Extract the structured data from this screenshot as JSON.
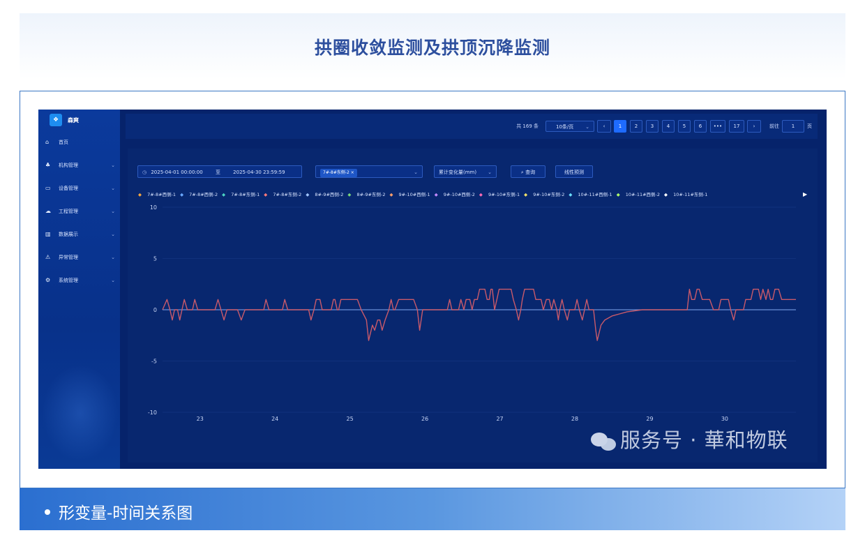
{
  "header": {
    "title": "拱圈收敛监测及拱顶沉降监测"
  },
  "app": {
    "logo_text": "森爽",
    "menu": [
      {
        "label": "首页",
        "icon": "home-icon",
        "glyph": "⌂",
        "chev": ""
      },
      {
        "label": "机构管理",
        "icon": "org-icon",
        "glyph": "♣",
        "chev": "⌄"
      },
      {
        "label": "设备管理",
        "icon": "monitor-icon",
        "glyph": "▭",
        "chev": "⌄"
      },
      {
        "label": "工程管理",
        "icon": "cloud-icon",
        "glyph": "☁",
        "chev": "⌄"
      },
      {
        "label": "数据展示",
        "icon": "book-icon",
        "glyph": "▥",
        "chev": "⌄"
      },
      {
        "label": "异常管理",
        "icon": "warning-icon",
        "glyph": "⚠",
        "chev": "⌄"
      },
      {
        "label": "系统管理",
        "icon": "gear-icon",
        "glyph": "⚙",
        "chev": "⌄"
      }
    ],
    "pager": {
      "total": "共 169 条",
      "page_size": "10条/页",
      "pages": [
        "1",
        "2",
        "3",
        "4",
        "5",
        "6",
        "•••",
        "17"
      ],
      "goto_label": "前往",
      "goto_value": "1",
      "page_unit": "页"
    },
    "filters": {
      "start": "2025-04-01 00:00:00",
      "to": "至",
      "end": "2025-04-30 23:59:59",
      "tag": "7#-8#东侧-2",
      "metric": "累计变化量(mm)",
      "query_button": "查询",
      "predict_button": "线性预测"
    },
    "legend": [
      "7#-8#西侧-1",
      "7#-8#西侧-2",
      "7#-8#东侧-1",
      "7#-8#东侧-2",
      "8#-9#西侧-2",
      "8#-9#东侧-2",
      "9#-10#西侧-1",
      "9#-10#西侧-2",
      "9#-10#东侧-1",
      "9#-10#东侧-2",
      "10#-11#西侧-1",
      "10#-11#西侧-2",
      "10#-11#东侧-1"
    ],
    "legend_colors": [
      "#f4a640",
      "#6aa8ff",
      "#4cd3c2",
      "#ff7a7a",
      "#a0c4ff",
      "#7ad67a",
      "#ff9f6a",
      "#c38aff",
      "#ff6ab4",
      "#f0e06a",
      "#6ae0ff",
      "#b0ff6a",
      "#ffffff"
    ]
  },
  "chart_data": {
    "type": "line",
    "title": "",
    "xlabel": "",
    "ylabel": "",
    "y_ticks": [
      "10",
      "5",
      "0",
      "-5",
      "-10"
    ],
    "ylim": [
      -10,
      10
    ],
    "x_ticks": [
      "23",
      "24",
      "25",
      "26",
      "27",
      "28",
      "29",
      "30"
    ],
    "x_range": [
      22.5,
      30.95
    ],
    "series": [
      {
        "name": "7#-8#东侧-2",
        "color": "#c95a6a",
        "points": [
          [
            22.5,
            0
          ],
          [
            22.56,
            1
          ],
          [
            22.6,
            0
          ],
          [
            22.63,
            -1
          ],
          [
            22.66,
            0
          ],
          [
            22.7,
            0
          ],
          [
            22.73,
            -1
          ],
          [
            22.76,
            0
          ],
          [
            22.79,
            1
          ],
          [
            22.83,
            0
          ],
          [
            22.9,
            0
          ],
          [
            22.93,
            1
          ],
          [
            22.97,
            0
          ],
          [
            23.2,
            0
          ],
          [
            23.24,
            1
          ],
          [
            23.28,
            0
          ],
          [
            23.32,
            -1
          ],
          [
            23.36,
            0
          ],
          [
            23.5,
            0
          ],
          [
            23.55,
            -1
          ],
          [
            23.6,
            0
          ],
          [
            23.85,
            0
          ],
          [
            23.88,
            1
          ],
          [
            23.92,
            0
          ],
          [
            24.1,
            0
          ],
          [
            24.13,
            1
          ],
          [
            24.17,
            0
          ],
          [
            24.45,
            0
          ],
          [
            24.48,
            -1
          ],
          [
            24.52,
            0
          ],
          [
            24.55,
            1
          ],
          [
            24.6,
            1
          ],
          [
            24.63,
            0
          ],
          [
            24.75,
            0
          ],
          [
            24.78,
            1
          ],
          [
            24.8,
            1
          ],
          [
            24.83,
            0
          ],
          [
            24.85,
            0
          ],
          [
            24.88,
            1
          ],
          [
            25.1,
            1
          ],
          [
            25.15,
            0
          ],
          [
            25.22,
            -1
          ],
          [
            25.25,
            -3
          ],
          [
            25.3,
            -1.5
          ],
          [
            25.33,
            -2
          ],
          [
            25.37,
            -1
          ],
          [
            25.4,
            -1
          ],
          [
            25.43,
            -2
          ],
          [
            25.47,
            -1
          ],
          [
            25.52,
            0
          ],
          [
            25.55,
            1
          ],
          [
            25.58,
            0
          ],
          [
            25.6,
            0
          ],
          [
            25.65,
            1
          ],
          [
            25.85,
            1
          ],
          [
            25.9,
            0
          ],
          [
            25.93,
            -2
          ],
          [
            25.97,
            0
          ],
          [
            26.3,
            0
          ],
          [
            26.33,
            1
          ],
          [
            26.36,
            0
          ],
          [
            26.45,
            0
          ],
          [
            26.48,
            1
          ],
          [
            26.52,
            0
          ],
          [
            26.55,
            1
          ],
          [
            26.6,
            1
          ],
          [
            26.63,
            0
          ],
          [
            26.66,
            1
          ],
          [
            26.7,
            1
          ],
          [
            26.73,
            2
          ],
          [
            26.8,
            2
          ],
          [
            26.83,
            1
          ],
          [
            26.86,
            1
          ],
          [
            26.88,
            2
          ],
          [
            26.9,
            2
          ],
          [
            26.93,
            0
          ],
          [
            26.96,
            1
          ],
          [
            26.99,
            2
          ],
          [
            27.15,
            2
          ],
          [
            27.18,
            1
          ],
          [
            27.22,
            0
          ],
          [
            27.25,
            -1
          ],
          [
            27.28,
            0
          ],
          [
            27.3,
            1
          ],
          [
            27.33,
            2
          ],
          [
            27.45,
            2
          ],
          [
            27.48,
            1
          ],
          [
            27.55,
            1
          ],
          [
            27.58,
            0
          ],
          [
            27.62,
            1
          ],
          [
            27.66,
            1
          ],
          [
            27.69,
            0
          ],
          [
            27.72,
            1
          ],
          [
            27.76,
            0
          ],
          [
            27.78,
            -1
          ],
          [
            27.8,
            0
          ],
          [
            27.83,
            1
          ],
          [
            27.86,
            0
          ],
          [
            27.9,
            -1
          ],
          [
            27.93,
            0
          ],
          [
            28.0,
            0
          ],
          [
            28.03,
            1
          ],
          [
            28.06,
            0
          ],
          [
            28.1,
            -1
          ],
          [
            28.13,
            0
          ],
          [
            28.16,
            1
          ],
          [
            28.19,
            0
          ],
          [
            28.25,
            0
          ],
          [
            28.28,
            -2
          ],
          [
            28.3,
            -3
          ],
          [
            28.35,
            -1.5
          ],
          [
            28.4,
            -1
          ],
          [
            28.5,
            -0.6
          ],
          [
            28.7,
            -0.2
          ],
          [
            28.9,
            0
          ],
          [
            29.0,
            0
          ],
          [
            29.5,
            0
          ],
          [
            29.53,
            2
          ],
          [
            29.56,
            1
          ],
          [
            29.6,
            1
          ],
          [
            29.63,
            2
          ],
          [
            29.66,
            2
          ],
          [
            29.7,
            1
          ],
          [
            29.8,
            1
          ],
          [
            29.85,
            0
          ],
          [
            29.92,
            0
          ],
          [
            29.95,
            1
          ],
          [
            30.05,
            1
          ],
          [
            30.08,
            0
          ],
          [
            30.12,
            -1
          ],
          [
            30.15,
            0
          ],
          [
            30.25,
            0
          ],
          [
            30.28,
            1
          ],
          [
            30.35,
            1
          ],
          [
            30.38,
            2
          ],
          [
            30.45,
            2
          ],
          [
            30.48,
            1
          ],
          [
            30.51,
            2
          ],
          [
            30.55,
            1
          ],
          [
            30.58,
            2
          ],
          [
            30.61,
            1
          ],
          [
            30.64,
            1
          ],
          [
            30.67,
            2
          ],
          [
            30.72,
            2
          ],
          [
            30.76,
            1
          ],
          [
            30.95,
            1
          ]
        ]
      },
      {
        "name": "",
        "color": "#6a8fd8",
        "points": [
          [
            22.5,
            0
          ],
          [
            30.95,
            0
          ]
        ]
      }
    ]
  },
  "watermark": {
    "text": "服务号 · 華和物联"
  },
  "caption": {
    "text": "形变量-时间关系图"
  }
}
